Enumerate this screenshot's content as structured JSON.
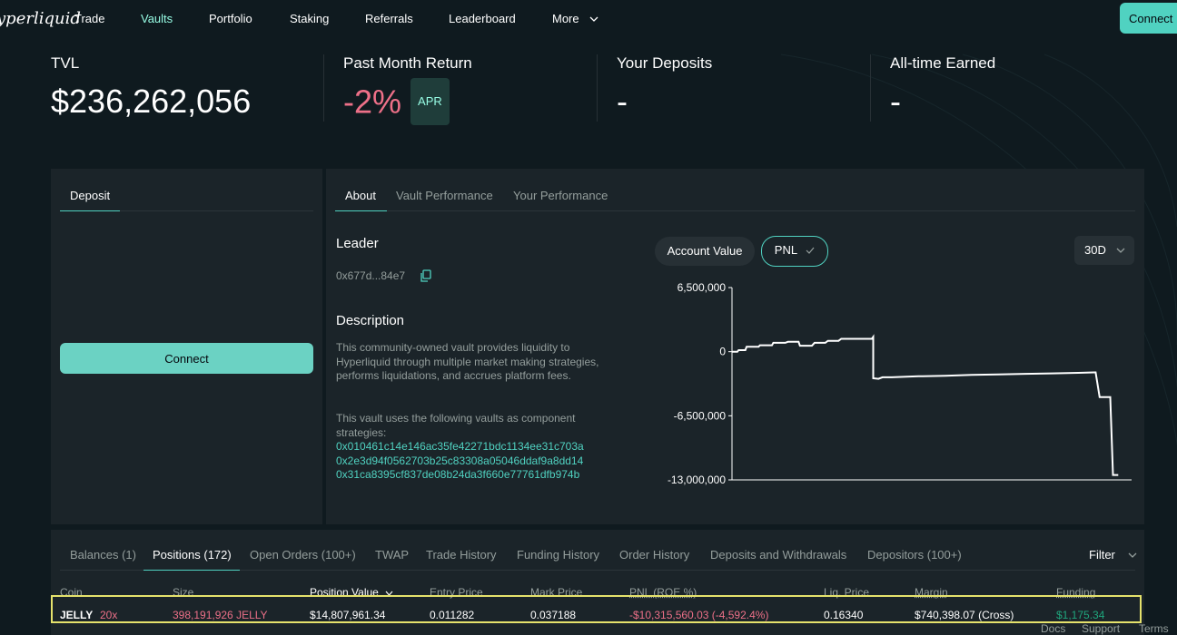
{
  "nav": {
    "logo": "yperliquid",
    "items": [
      "Trade",
      "Vaults",
      "Portfolio",
      "Staking",
      "Referrals",
      "Leaderboard",
      "More"
    ],
    "connect_label": "Connect"
  },
  "stats": {
    "tvl_label": "TVL",
    "tvl_value": "$236,262,056",
    "return_label": "Past Month Return",
    "return_value": "-2%",
    "apr_badge": "APR",
    "deposits_label": "Your Deposits",
    "deposits_value": "-",
    "earned_label": "All-time Earned",
    "earned_value": "-"
  },
  "deposit_panel": {
    "tab_label": "Deposit",
    "connect_label": "Connect"
  },
  "about_panel": {
    "tabs": [
      "About",
      "Vault Performance",
      "Your Performance"
    ],
    "leader_title": "Leader",
    "leader_address": "0x677d...84e7",
    "description_title": "Description",
    "description_text": "This community-owned vault provides liquidity to Hyperliquid through multiple market making strategies, performs liquidations, and accrues platform fees.",
    "components_text": "This vault uses the following vaults as component strategies:",
    "component_vaults": [
      "0x010461c14e146ac35fe42271bdc1134ee31c703a",
      "0x2e3d94f0562703b25c83308a05046ddaf9a8dd14",
      "0x31ca8395cf837de08b24da3f660e77761dfb974b"
    ],
    "chart_toggles": [
      "Account Value",
      "PNL"
    ],
    "range": "30D"
  },
  "colors": {
    "accent": "#50d2c1",
    "accent_light": "#97fce4",
    "negative": "#ed7088",
    "positive": "#1fa67d",
    "highlight": "#e5e26c"
  },
  "chart_data": {
    "type": "line",
    "title": "",
    "xlabel": "",
    "ylabel": "",
    "y_ticks": [
      "6,500,000",
      "0",
      "-6,500,000",
      "-13,000,000"
    ],
    "y_tick_values": [
      6500000,
      0,
      -6500000,
      -13000000
    ],
    "ylim": [
      -13000000,
      6500000
    ],
    "xlim": [
      0,
      30
    ],
    "grid": false,
    "series": [
      {
        "x": [
          0,
          0.4,
          0.5,
          1.0,
          1.1,
          2.0,
          2.1,
          3.0,
          3.1,
          4.0,
          4.2,
          5.0,
          5.1,
          6.0,
          6.2,
          7.0,
          7.2,
          8.0,
          8.2,
          9.0,
          9.2,
          10.5,
          10.6,
          10.6,
          11.0,
          11.3,
          12.0,
          14.0,
          16.0,
          18.0,
          20.0,
          22.0,
          24.0,
          26.0,
          27.2,
          27.3,
          27.6,
          28.4,
          28.6,
          29.0
        ],
        "y": [
          -5000,
          0,
          150000,
          150000,
          500000,
          500000,
          650000,
          650000,
          900000,
          900000,
          1000000,
          1000000,
          600000,
          600000,
          900000,
          900000,
          1100000,
          1100000,
          1300000,
          1300000,
          1300000,
          1300000,
          1500000,
          -2700000,
          -2750000,
          -2600000,
          -2600000,
          -2500000,
          -2450000,
          -2350000,
          -2300000,
          -2250000,
          -2200000,
          -2150000,
          -2100000,
          -2100000,
          -4600000,
          -4600000,
          -12500000,
          -12500000
        ]
      }
    ]
  },
  "bottom_tabs": [
    "Balances (1)",
    "Positions (172)",
    "Open Orders (100+)",
    "TWAP",
    "Trade History",
    "Funding History",
    "Order History",
    "Deposits and Withdrawals",
    "Depositors (100+)"
  ],
  "filter_label": "Filter",
  "positions_table": {
    "columns": [
      "Coin",
      "Size",
      "Position Value",
      "Entry Price",
      "Mark Price",
      "PNL (ROE %)",
      "Liq. Price",
      "Margin",
      "Funding"
    ],
    "rows": [
      {
        "coin": "JELLY",
        "leverage": "20x",
        "size": "398,191,926 JELLY",
        "position_value": "$14,807,961.34",
        "entry_price": "0.011282",
        "mark_price": "0.037188",
        "pnl": "-$10,315,560.03 (-4,592.4%)",
        "liq_price": "0.16340",
        "margin": "$740,398.07 (Cross)",
        "funding": "$1,175.34"
      }
    ]
  },
  "footer": [
    "Docs",
    "Support",
    "Terms"
  ]
}
